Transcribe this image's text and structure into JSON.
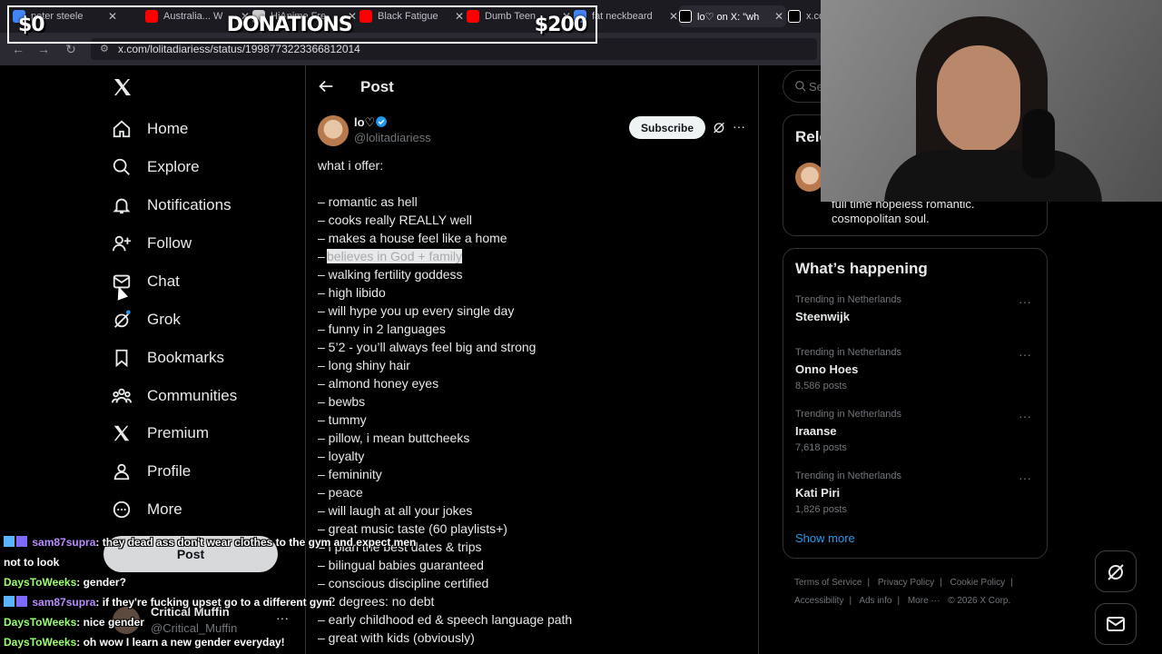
{
  "browser": {
    "tabs": [
      {
        "title": "peter steele",
        "favicon": "chrome-icon",
        "color": "#4285f4"
      },
      {
        "title": "Australia... W",
        "favicon": "youtube-icon",
        "color": "#ff0000"
      },
      {
        "title": "HiAnime Fre",
        "favicon": "hianime-icon",
        "color": "#cccccc"
      },
      {
        "title": "Black Fatigue",
        "favicon": "youtube-icon",
        "color": "#ff0000"
      },
      {
        "title": "Dumb Teen",
        "favicon": "youtube-icon",
        "color": "#ff0000"
      },
      {
        "title": "fat neckbeard",
        "favicon": "chrome-icon",
        "color": "#4285f4"
      },
      {
        "title": "lo♡ on X: \"wh",
        "favicon": "x-icon",
        "color": "#ffffff"
      },
      {
        "title": "x.co",
        "favicon": "x-icon",
        "color": "#ffffff"
      }
    ],
    "url": "x.com/lolitadiariess/status/1998773223366812014"
  },
  "overlay": {
    "left_amount": "$0",
    "title": "DONATIONS",
    "right_amount": "$200"
  },
  "sidebar": {
    "items": [
      {
        "label": "Home",
        "icon": "home-icon"
      },
      {
        "label": "Explore",
        "icon": "search-icon"
      },
      {
        "label": "Notifications",
        "icon": "bell-icon"
      },
      {
        "label": "Follow",
        "icon": "person-add-icon"
      },
      {
        "label": "Chat",
        "icon": "mail-icon"
      },
      {
        "label": "Grok",
        "icon": "grok-icon"
      },
      {
        "label": "Bookmarks",
        "icon": "bookmark-icon"
      },
      {
        "label": "Communities",
        "icon": "communities-icon"
      },
      {
        "label": "Premium",
        "icon": "x-icon"
      },
      {
        "label": "Profile",
        "icon": "person-icon"
      },
      {
        "label": "More",
        "icon": "more-circle-icon"
      }
    ],
    "post_button": "Post",
    "account": {
      "name": "Critical Muffin",
      "handle": "@Critical_Muffin",
      "more": "···"
    }
  },
  "post": {
    "header": "Post",
    "author": {
      "name": "lo♡",
      "handle": "@lolitadiariess"
    },
    "subscribe": "Subscribe",
    "more": "···",
    "lines": [
      "what i offer:",
      "",
      "– romantic as hell",
      "– cooks really REALLY well",
      "– makes a house feel like a home",
      "– ",
      "– walking fertility goddess",
      "– high libido",
      "– will hype you up every single day",
      "– funny in 2 languages",
      "– 5’2 - you’ll always feel big and strong",
      "– long shiny hair",
      "– almond honey eyes",
      "– bewbs",
      "– tummy",
      "– pillow, i mean buttcheeks",
      "– loyalty",
      "– femininity",
      "– peace",
      "– will laugh at all your jokes",
      "– great music taste (60 playlists+)",
      "– i plan the best dates & trips",
      "– bilingual babies guaranteed",
      "– conscious discipline certified",
      "– 2 degrees: no debt",
      "– early childhood ed & speech language path",
      "– great with kids (obviously)"
    ],
    "highlighted": "believes in God + family"
  },
  "right": {
    "search_placeholder": "Se",
    "relevant_title": "Rele",
    "bio_line1": "full time hopeless romantic.",
    "bio_line2": "cosmopolitan soul.",
    "happening_title": "What’s happening",
    "trends": [
      {
        "context": "Trending in Netherlands",
        "name": "Steenwijk",
        "count": ""
      },
      {
        "context": "Trending in Netherlands",
        "name": "Onno Hoes",
        "count": "8,586 posts"
      },
      {
        "context": "Trending in Netherlands",
        "name": "Iraanse",
        "count": "7,618 posts"
      },
      {
        "context": "Trending in Netherlands",
        "name": "Kati Piri",
        "count": "1,826 posts"
      }
    ],
    "show_more": "Show more",
    "footer": {
      "terms": "Terms of Service",
      "privacy": "Privacy Policy",
      "cookie": "Cookie Policy",
      "accessibility": "Accessibility",
      "ads": "Ads info",
      "more": "More ···",
      "copyright": "© 2026 X Corp."
    }
  },
  "chat": [
    {
      "user": "sam87supra",
      "message": ": they dead ass don't wear clothes to the gym and expect men",
      "cont": "not to look",
      "badge": true
    },
    {
      "user": "DaysToWeeks",
      "message": ": gender?",
      "badge": false
    },
    {
      "user": "sam87supra",
      "message": ": if they're fucking upset go to a different gym",
      "badge": true
    },
    {
      "user": "DaysToWeeks",
      "message": ": nice gender",
      "badge": false
    },
    {
      "user": "DaysToWeeks",
      "message": ": oh wow I learn a new gender everyday!",
      "badge": false
    }
  ]
}
